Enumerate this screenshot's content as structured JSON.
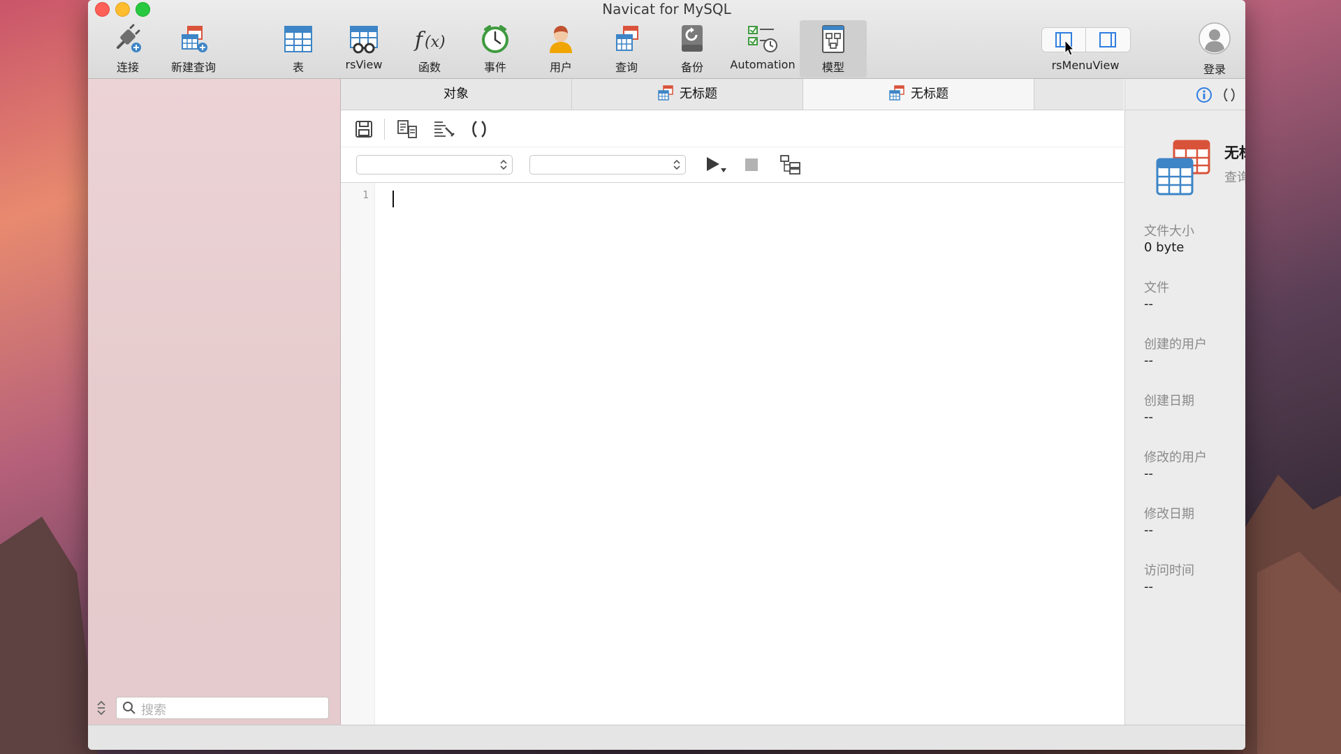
{
  "window": {
    "title": "Navicat for MySQL"
  },
  "toolbar": {
    "connect": "连接",
    "new_query": "新建查询",
    "table": "表",
    "view": "rsView",
    "function": "函数",
    "event": "事件",
    "user": "用户",
    "query": "查询",
    "backup": "备份",
    "automation": "Automation",
    "model": "模型",
    "menu_view": "rsMenuView",
    "login": "登录"
  },
  "sidebar": {
    "search_placeholder": "搜索"
  },
  "tabs": [
    {
      "label": "对象"
    },
    {
      "label": "无标题"
    },
    {
      "label": "无标题"
    }
  ],
  "editor": {
    "line_numbers": [
      "1"
    ]
  },
  "inspector": {
    "name": "无标题",
    "type": "查询",
    "fields": [
      {
        "label": "文件大小",
        "value": "0 byte"
      },
      {
        "label": "文件",
        "value": "--"
      },
      {
        "label": "创建的用户",
        "value": "--"
      },
      {
        "label": "创建日期",
        "value": "--"
      },
      {
        "label": "修改的用户",
        "value": "--"
      },
      {
        "label": "修改日期",
        "value": "--"
      },
      {
        "label": "访问时间",
        "value": "--"
      }
    ]
  },
  "colors": {
    "accent_blue": "#3d85c6",
    "accent_red": "#d9533b",
    "info_blue": "#2f7de1"
  }
}
